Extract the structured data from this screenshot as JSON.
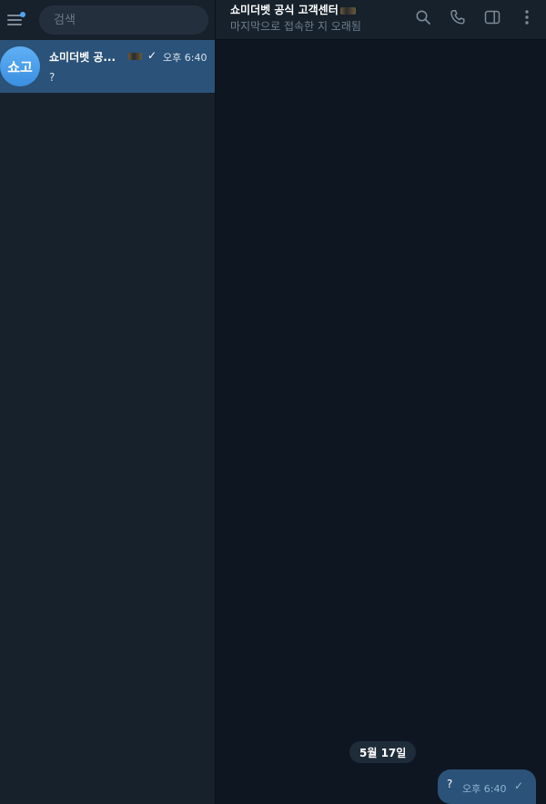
{
  "search": {
    "placeholder": "검색"
  },
  "chat_list": [
    {
      "avatar_initials": "쇼고",
      "name": "쇼미더벳 공...",
      "check": "✓",
      "time": "오후 6:40",
      "preview": "?"
    }
  ],
  "chat_header": {
    "title": "쇼미더벳 공식 고객센터",
    "status": "마지막으로 접속한 지 오래됨"
  },
  "icons": {
    "menu": "menu-icon",
    "search": "search-icon",
    "phone": "phone-icon",
    "sidebar": "sidebar-toggle-icon",
    "more": "more-vertical-icon"
  },
  "messages": {
    "date_separator": "5월 17일",
    "items": [
      {
        "text": "?",
        "time": "오후 6:40",
        "check": "✓"
      }
    ]
  },
  "colors": {
    "accent": "#2b5278",
    "sidebar_bg": "#17212b",
    "chat_bg": "#0e1621",
    "avatar": "#4ea4f6",
    "unread_dot": "#4ea4f6"
  }
}
